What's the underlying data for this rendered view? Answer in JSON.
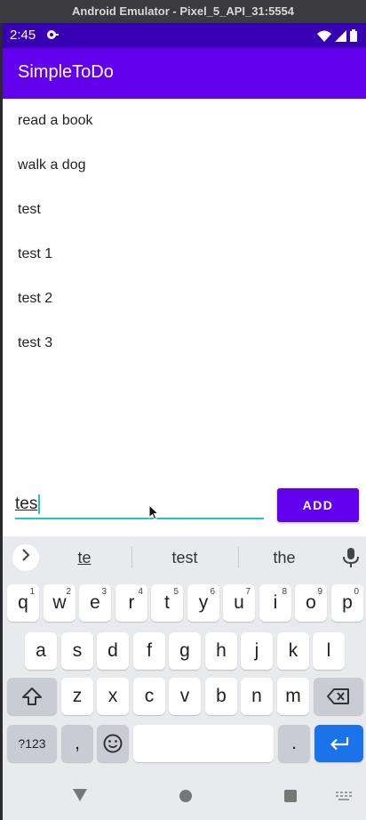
{
  "window": {
    "title": "Android Emulator - Pixel_5_API_31:5554"
  },
  "status_bar": {
    "time": "2:45"
  },
  "app": {
    "title": "SimpleToDo",
    "items": [
      "read a book",
      "walk a dog",
      "test",
      "test 1",
      "test 2",
      "test 3"
    ],
    "input_value": "tes",
    "add_label": "ADD"
  },
  "colors": {
    "status_bar": "#3700b3",
    "app_bar": "#6200ee",
    "accent": "#20c6c0",
    "keyboard_bg": "#e9eaee",
    "enter_key": "#1a73e8"
  },
  "keyboard": {
    "suggestions": [
      "te",
      "test",
      "the"
    ],
    "row1": [
      {
        "key": "q",
        "hint": "1"
      },
      {
        "key": "w",
        "hint": "2"
      },
      {
        "key": "e",
        "hint": "3"
      },
      {
        "key": "r",
        "hint": "4"
      },
      {
        "key": "t",
        "hint": "5"
      },
      {
        "key": "y",
        "hint": "6"
      },
      {
        "key": "u",
        "hint": "7"
      },
      {
        "key": "i",
        "hint": "8"
      },
      {
        "key": "o",
        "hint": "9"
      },
      {
        "key": "p",
        "hint": "0"
      }
    ],
    "row2": [
      "a",
      "s",
      "d",
      "f",
      "g",
      "h",
      "j",
      "k",
      "l"
    ],
    "row3": [
      "z",
      "x",
      "c",
      "v",
      "b",
      "n",
      "m"
    ],
    "symbols_label": "?123",
    "comma": ",",
    "period": ".",
    "icons": {
      "shift": "shift-icon",
      "backspace": "backspace-icon",
      "emoji": "emoji-icon",
      "enter": "enter-icon",
      "mic": "mic-icon",
      "expand": "chevron-right-icon"
    }
  },
  "nav_bar": {
    "icons": [
      "back-triangle-icon",
      "home-circle-icon",
      "recents-square-icon",
      "keyboard-switch-icon"
    ]
  }
}
